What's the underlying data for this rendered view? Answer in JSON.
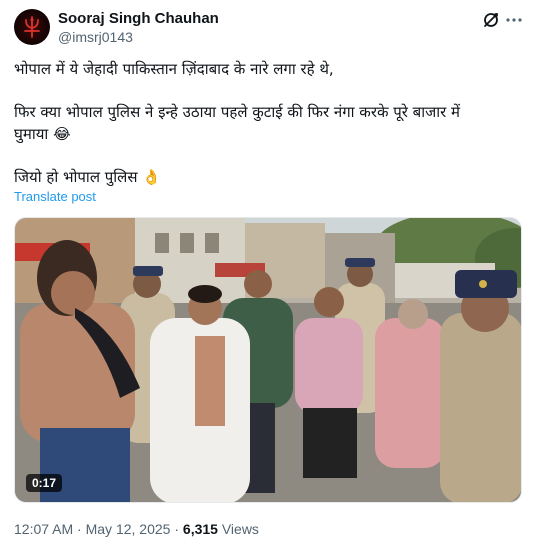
{
  "author": {
    "name": "Sooraj Singh Chauhan",
    "handle": "@imsrj0143"
  },
  "icons": {
    "avatar": "red-trident-emblem-avatar",
    "grok": "grok-slash-circle-icon",
    "more": "more-dots-icon"
  },
  "tweet": {
    "line1": "भोपाल में ये जेहादी पाकिस्तान ज़िंदाबाद के नारे लगा रहे थे,",
    "line2": "फिर क्या भोपाल पुलिस ने इन्हे उठाया पहले कुटाई की फिर नंगा करके पूरे बाजार में",
    "line3": "घुमाया 😂",
    "line4": "जियो हो भोपाल पुलिस 👌"
  },
  "translate_label": "Translate post",
  "media": {
    "duration": "0:17"
  },
  "meta": {
    "time": "12:07 AM",
    "separator": " · ",
    "date": "May 12, 2025",
    "views_count": "6,315",
    "views_label": " Views"
  },
  "colors": {
    "text": "#0f1419",
    "secondary": "#536471",
    "link": "#1d9bf0"
  }
}
